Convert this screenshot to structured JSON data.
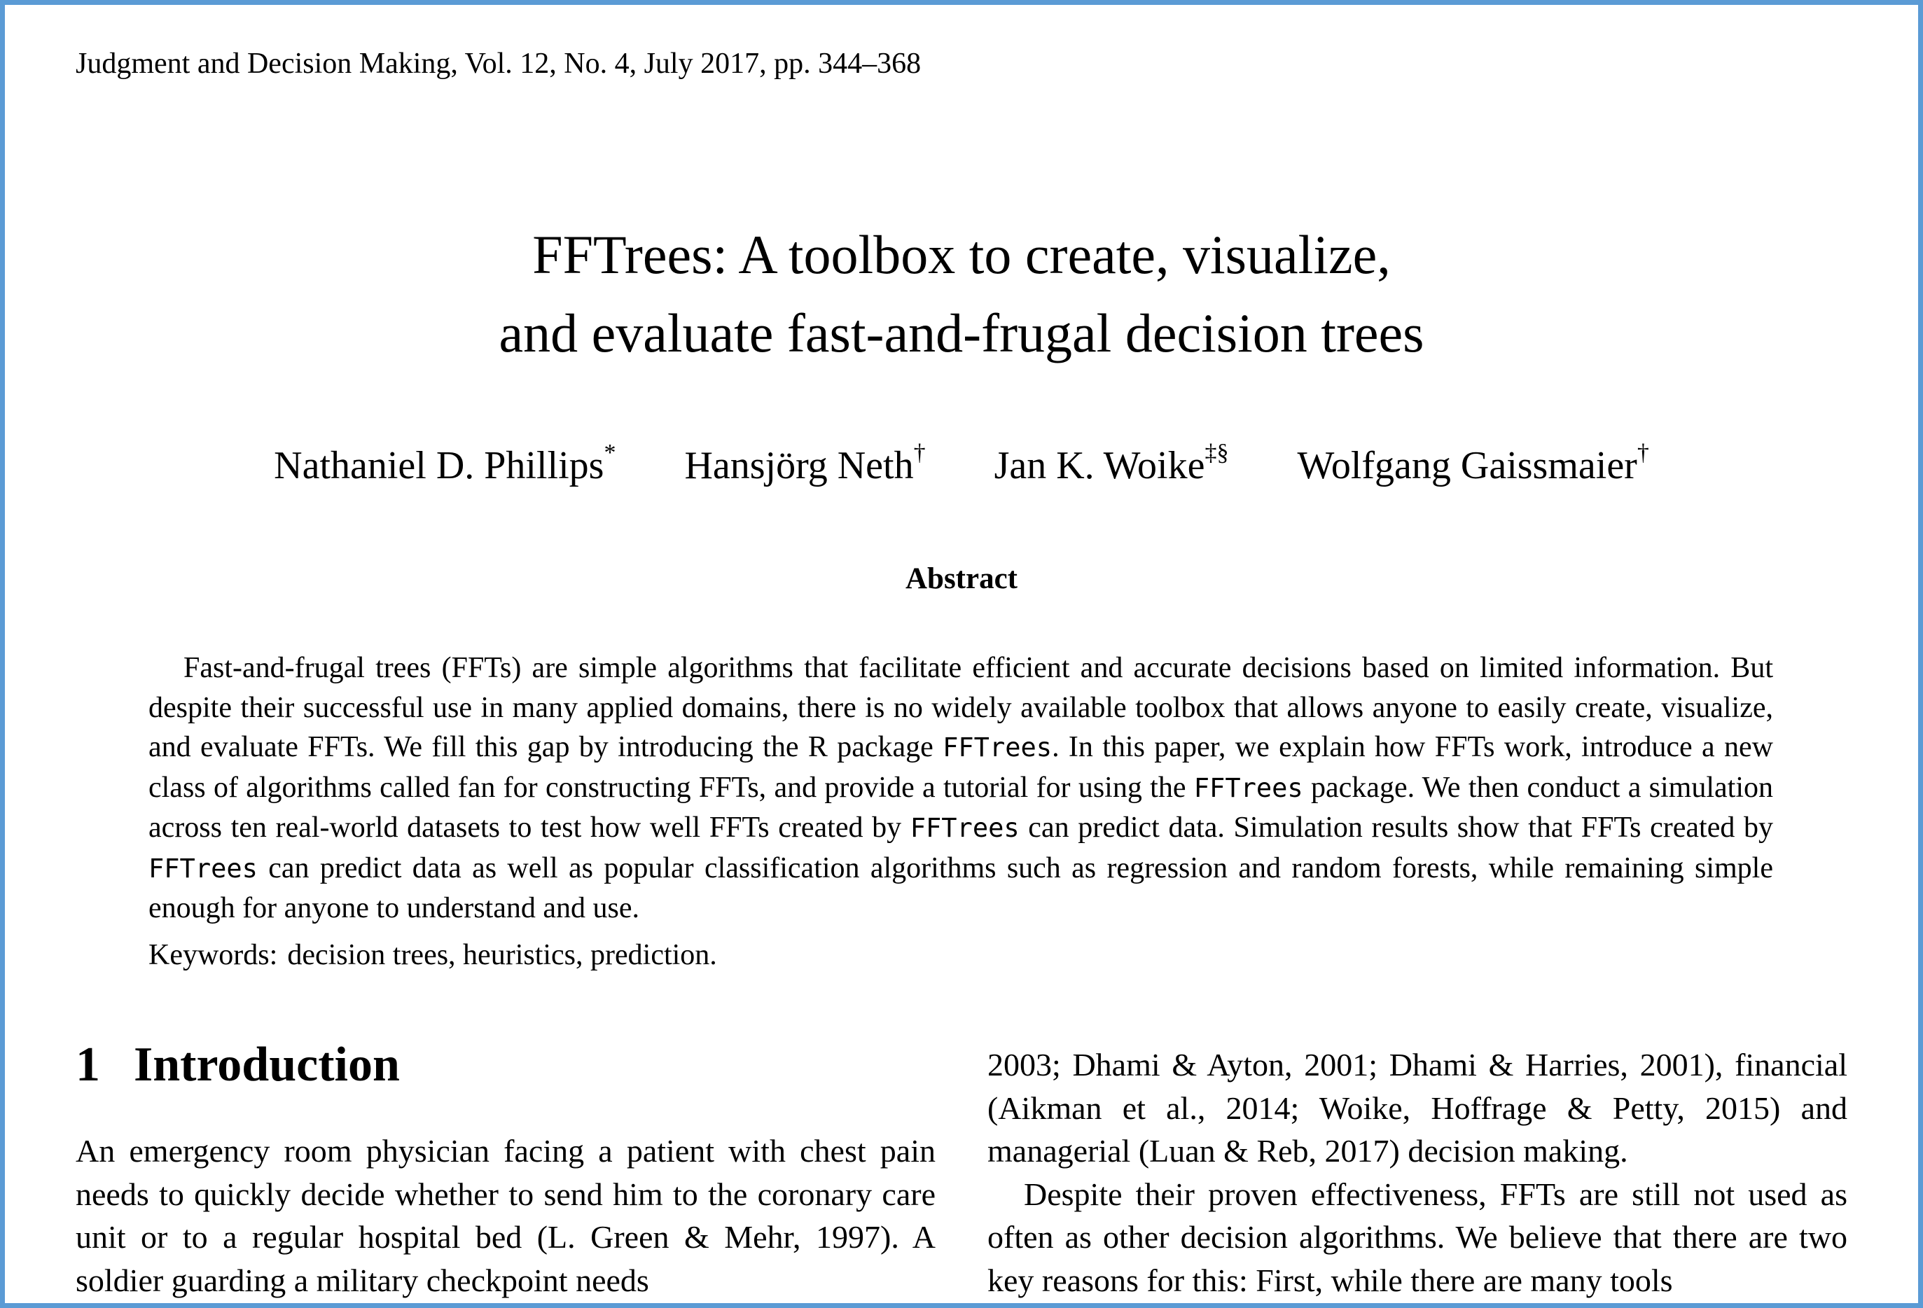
{
  "header": {
    "journal": "Judgment and Decision Making, Vol. 12, No. 4, July 2017, pp. 344–368"
  },
  "title": {
    "line1": "FFTrees: A toolbox to create, visualize,",
    "line2": "and evaluate fast-and-frugal decision trees"
  },
  "authors": [
    {
      "name": "Nathaniel D. Phillips",
      "mark": "*"
    },
    {
      "name": "Hansjörg Neth",
      "mark": "†"
    },
    {
      "name": "Jan K. Woike",
      "mark": "‡§"
    },
    {
      "name": "Wolfgang Gaissmaier",
      "mark": "†"
    }
  ],
  "abstract": {
    "heading": "Abstract",
    "parts": [
      "Fast-and-frugal trees (FFTs) are simple algorithms that facilitate efficient and accurate decisions based on limited information. But despite their successful use in many applied domains, there is no widely available toolbox that allows anyone to easily create, visualize, and evaluate FFTs. We fill this gap by introducing the R package ",
      "FFTrees",
      ". In this paper, we explain how FFTs work, introduce a new class of algorithms called fan for constructing FFTs, and provide a tutorial for using the ",
      "FFTrees",
      " package. We then conduct a simulation across ten real-world datasets to test how well FFTs created by ",
      "FFTrees",
      " can predict data. Simulation results show that FFTs created by ",
      "FFTrees",
      " can predict data as well as popular classification algorithms such as regression and random forests, while remaining simple enough for anyone to understand and use."
    ]
  },
  "keywords": {
    "label": "Keywords:",
    "value": "decision trees, heuristics, prediction."
  },
  "section": {
    "number": "1",
    "title": "Introduction"
  },
  "body": {
    "left_paragraph": "An emergency room physician facing a patient with chest pain needs to quickly decide whether to send him to the coronary care unit or to a regular hospital bed (L. Green & Mehr, 1997). A soldier guarding a military checkpoint needs",
    "right_paragraph1": "2003; Dhami & Ayton, 2001; Dhami & Harries, 2001), financial (Aikman et al., 2014; Woike, Hoffrage & Petty, 2015) and managerial (Luan & Reb, 2017) decision making.",
    "right_paragraph2": "Despite their proven effectiveness, FFTs are still not used as often as other decision algorithms. We believe that there are two key reasons for this: First, while there are many tools"
  },
  "colors": {
    "frame_border": "#5b9bd5",
    "text": "#000000",
    "background": "#ffffff"
  }
}
